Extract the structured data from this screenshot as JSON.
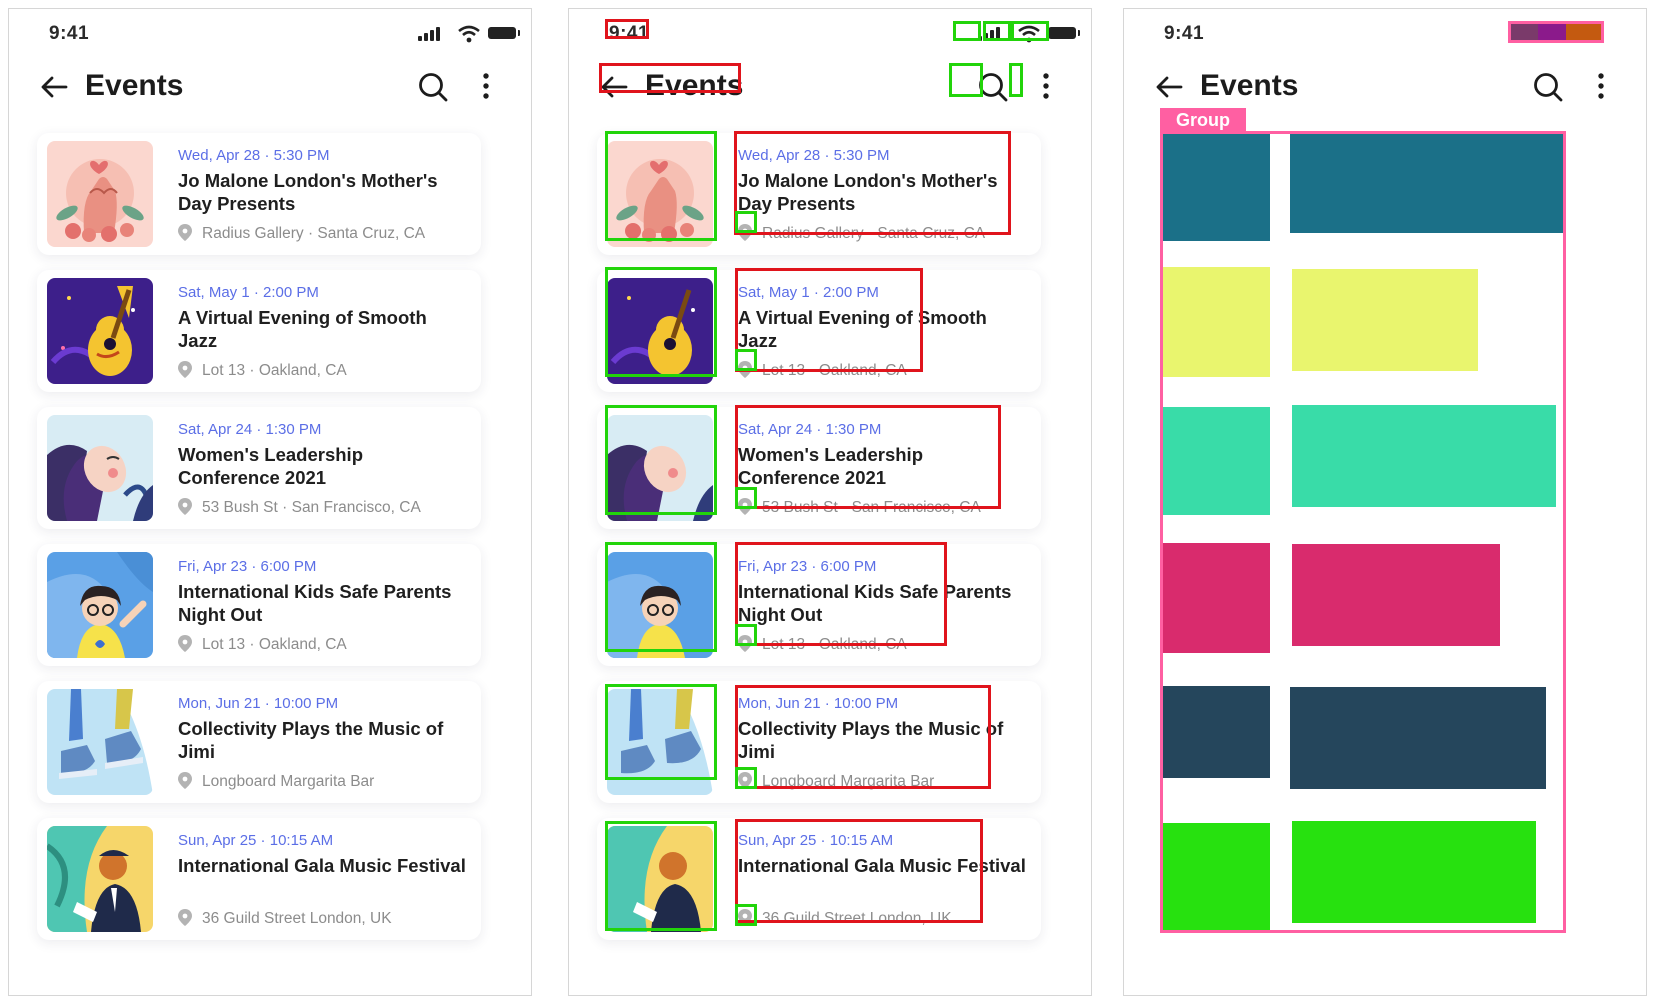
{
  "status_bar": {
    "time": "9:41"
  },
  "header": {
    "title": "Events"
  },
  "group_label": "Group",
  "events": [
    {
      "date": "Wed, Apr 28 · 5:30 PM",
      "title": "Jo Malone London's Mother's Day Presents",
      "location": "Radius Gallery · Santa Cruz, CA"
    },
    {
      "date": "Sat, May 1 · 2:00 PM",
      "title": "A Virtual Evening of Smooth Jazz",
      "location": "Lot 13 · Oakland, CA"
    },
    {
      "date": "Sat, Apr 24 · 1:30 PM",
      "title": "Women's Leadership Conference 2021",
      "location": "53 Bush St · San Francisco, CA"
    },
    {
      "date": "Fri, Apr 23 · 6:00 PM",
      "title": "International Kids Safe Parents Night Out",
      "location": "Lot 13 · Oakland, CA"
    },
    {
      "date": "Mon, Jun 21 · 10:00 PM",
      "title": "Collectivity Plays the Music of Jimi",
      "location": "Longboard Margarita Bar"
    },
    {
      "date": "Sun, Apr 25 · 10:15 AM",
      "title": "International Gala Music Festival",
      "location": "36 Guild Street London, UK"
    }
  ],
  "group_colors": [
    [
      "#1b7088",
      "#1b7088"
    ],
    [
      "#e9f56e",
      "#e9f56e"
    ],
    [
      "#39dca8",
      "#39dca8"
    ],
    [
      "#d92b6d",
      "#d92b6d"
    ],
    [
      "#25465c",
      "#25465c"
    ],
    [
      "#27e10f",
      "#27e10f"
    ]
  ],
  "status_colors": [
    "#7a3a6a",
    "#8b1a8b",
    "#c45a10"
  ],
  "colors": {
    "accent": "#5b6ee6",
    "annotation_red": "#e0141c",
    "annotation_green": "#22d40a",
    "group_pink": "#ff5fa2"
  },
  "icons": [
    "back-arrow-icon",
    "search-icon",
    "more-vertical-icon",
    "location-pin-icon",
    "signal-icon",
    "wifi-icon",
    "battery-icon"
  ]
}
